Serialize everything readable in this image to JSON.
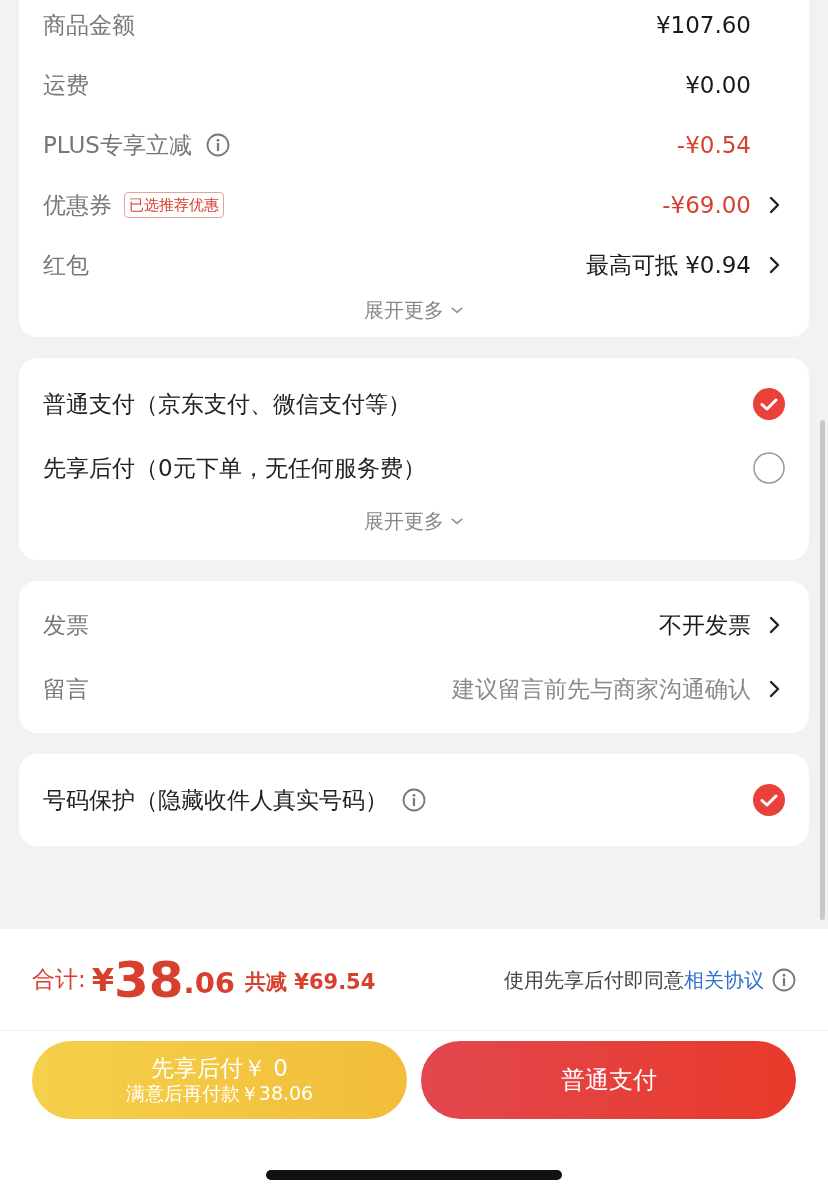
{
  "summary": {
    "rows": [
      {
        "label": "商品金额",
        "value": "¥107.60",
        "discount": false,
        "info": false,
        "link": false
      },
      {
        "label": "运费",
        "value": "¥0.00",
        "discount": false,
        "info": false,
        "link": false
      },
      {
        "label": "PLUS专享立减",
        "value": "-¥0.54",
        "discount": true,
        "info": true,
        "link": false
      },
      {
        "label": "优惠券",
        "tag": "已选推荐优惠",
        "value": "-¥69.00",
        "discount": true,
        "info": false,
        "link": true
      },
      {
        "label": "红包",
        "value": "最高可抵 ¥0.94",
        "discount": false,
        "info": false,
        "link": true
      }
    ],
    "expand": "展开更多"
  },
  "payment": {
    "options": [
      {
        "label": "普通支付（京东支付、微信支付等）",
        "selected": true
      },
      {
        "label": "先享后付（0元下单，无任何服务费）",
        "selected": false
      }
    ],
    "expand": "展开更多"
  },
  "extras": {
    "rows": [
      {
        "label": "发票",
        "value": "不开发票",
        "muted": false
      },
      {
        "label": "留言",
        "value": "建议留言前先与商家沟通确认",
        "muted": true
      }
    ]
  },
  "privacy": {
    "label": "号码保护（隐藏收件人真实号码）",
    "checked": true
  },
  "footer": {
    "total_label": "合计:",
    "currency": "¥",
    "amount_int": "38",
    "amount_dec": ".06",
    "saving": "共减 ¥69.54",
    "agreement": "使用先享后付即同意",
    "agreement_link": "相关协议",
    "buttons": [
      {
        "kind": "later",
        "title": "先享后付￥ 0",
        "subtitle": "满意后再付款￥38.06"
      },
      {
        "kind": "normal",
        "title": "普通支付"
      }
    ]
  }
}
